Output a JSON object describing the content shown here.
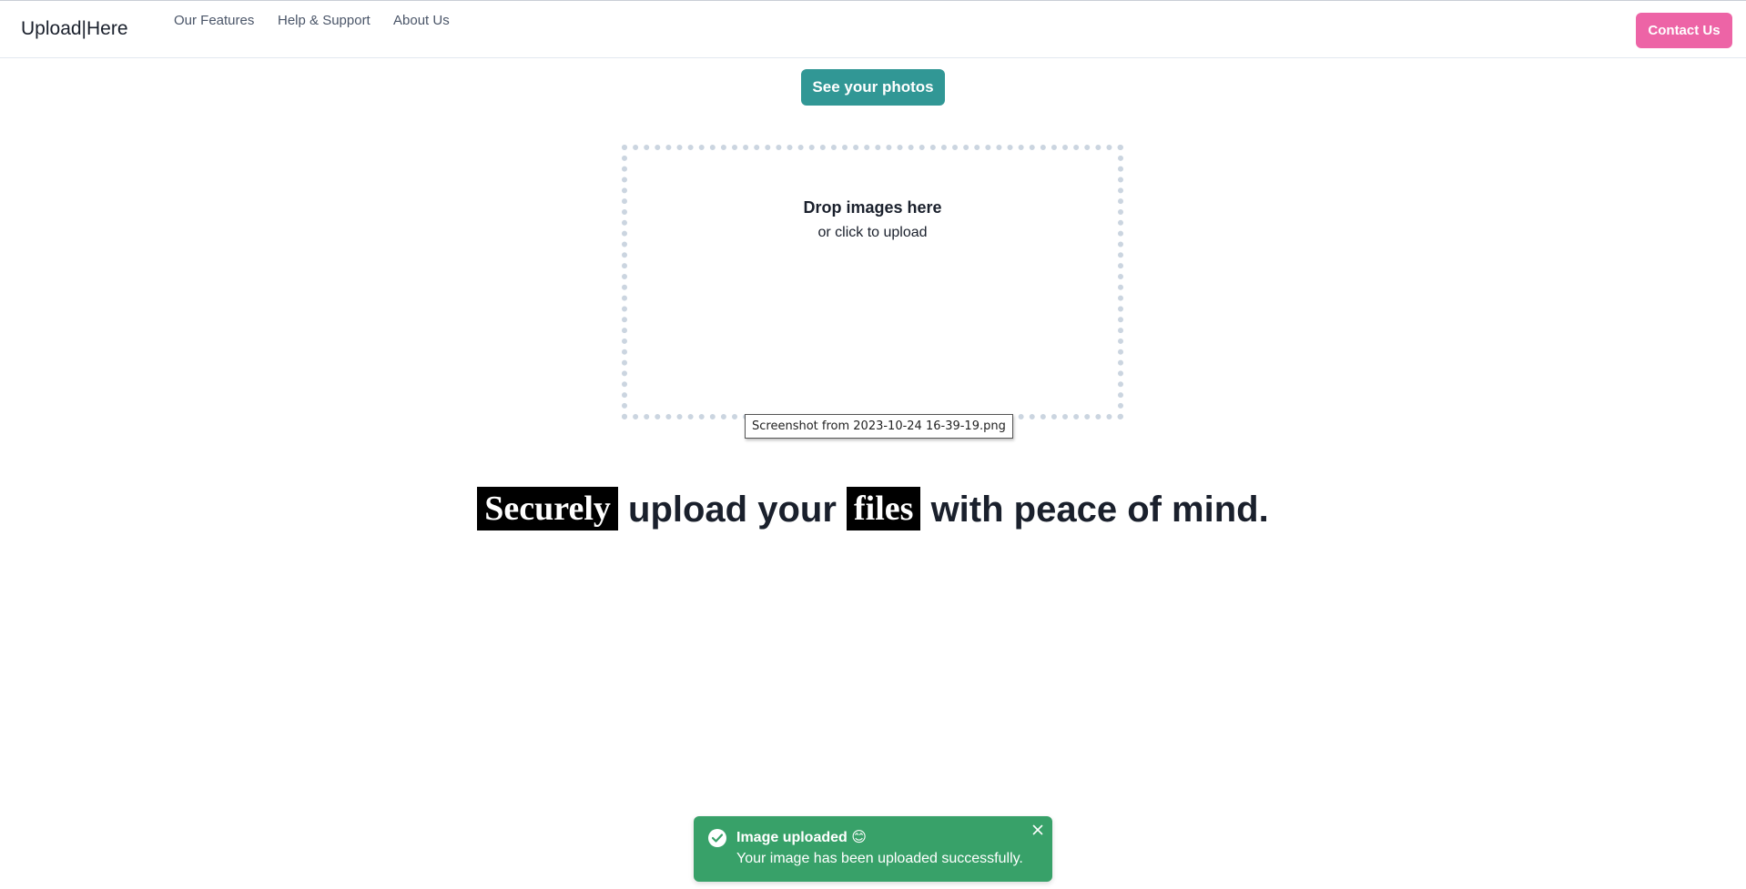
{
  "navbar": {
    "brand": "Upload|Here",
    "links": [
      {
        "label": "Our Features"
      },
      {
        "label": "Help & Support"
      },
      {
        "label": "About Us"
      }
    ],
    "contact_label": "Contact Us"
  },
  "actions": {
    "see_photos_label": "See your photos"
  },
  "dropzone": {
    "title": "Drop images here",
    "subtitle": "or click to upload",
    "tooltip": "Screenshot from 2023-10-24 16-39-19.png"
  },
  "headline": {
    "word1": "Securely",
    "text1": " upload your ",
    "word2": "files",
    "text2": " with peace of mind."
  },
  "toast": {
    "title": "Image uploaded 😊",
    "message": "Your image has been uploaded successfully.",
    "icon": "check-circle-icon",
    "close_icon": "close-icon"
  },
  "colors": {
    "contact": "#ed64a6",
    "see_photos": "#319795",
    "toast": "#38a169",
    "dropzone_border": "#cbd5e0"
  }
}
